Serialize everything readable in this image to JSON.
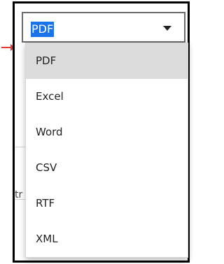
{
  "select": {
    "selected_value": "PDF",
    "caret_icon": "chevron-down-icon"
  },
  "dropdown": {
    "options": [
      {
        "label": "PDF",
        "highlighted": true
      },
      {
        "label": "Excel",
        "highlighted": false
      },
      {
        "label": "Word",
        "highlighted": false
      },
      {
        "label": "CSV",
        "highlighted": false
      },
      {
        "label": "RTF",
        "highlighted": false
      },
      {
        "label": "XML",
        "highlighted": false
      }
    ]
  },
  "background": {
    "partial_text": "tr"
  },
  "colors": {
    "selection_highlight": "#1a73e8",
    "option_hover": "#dcdcdc",
    "annotation_arrow": "#e53935"
  }
}
